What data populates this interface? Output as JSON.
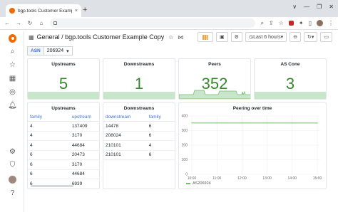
{
  "browser": {
    "tab_title": "bgp.tools Customer Example",
    "tab_close": "×",
    "new_tab": "+",
    "win_controls": [
      "∨",
      "—",
      "❐",
      "✕"
    ]
  },
  "header": {
    "breadcrumb_root": "General",
    "separator": "/",
    "title": "bgp.tools Customer Example Copy",
    "time_range": "Last 6 hours"
  },
  "variables": {
    "label": "ASN",
    "value": "206924",
    "caret": "▾"
  },
  "stats": [
    {
      "title": "Upstreams",
      "value": "5"
    },
    {
      "title": "Downstreams",
      "value": "1"
    },
    {
      "title": "Peers",
      "value": "352"
    },
    {
      "title": "AS Cone",
      "value": "3"
    }
  ],
  "upstreams_table": {
    "title": "Upstreams",
    "columns": [
      "family",
      "upstream"
    ],
    "rows": [
      [
        "4",
        "137409"
      ],
      [
        "4",
        "3170"
      ],
      [
        "4",
        "44684"
      ],
      [
        "6",
        "20473"
      ],
      [
        "6",
        "3170"
      ],
      [
        "6",
        "44684"
      ],
      [
        "6",
        "6939"
      ]
    ]
  },
  "downstreams_table": {
    "title": "Downstreams",
    "columns": [
      "downstream",
      "family"
    ],
    "rows": [
      [
        "14478",
        "6"
      ],
      [
        "208024",
        "6"
      ],
      [
        "210101",
        "4"
      ],
      [
        "210101",
        "6"
      ]
    ]
  },
  "peering_chart": {
    "title": "Peering over time",
    "legend": "AS206924",
    "colors": {
      "line": "#73bf69",
      "stat": "#37872d",
      "accent": "#3d71d9"
    }
  },
  "chart_data": {
    "type": "line",
    "title": "Peering over time",
    "xlabel": "",
    "ylabel": "",
    "x": [
      "10:00",
      "11:00",
      "12:00",
      "13:00",
      "14:00",
      "15:00"
    ],
    "ylim": [
      0,
      400
    ],
    "yticks": [
      "0",
      "100",
      "200",
      "300",
      "400"
    ],
    "series": [
      {
        "name": "AS206924",
        "values": [
          352,
          352,
          352,
          352,
          352,
          352
        ]
      }
    ],
    "grid": true,
    "legend_position": "bottom-left"
  }
}
